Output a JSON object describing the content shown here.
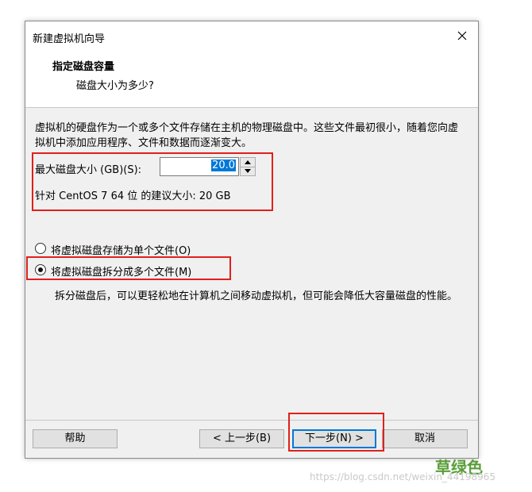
{
  "window": {
    "title": "新建虚拟机向导"
  },
  "header": {
    "title": "指定磁盘容量",
    "subtitle": "磁盘大小为多少?"
  },
  "content": {
    "description": "虚拟机的硬盘作为一个或多个文件存储在主机的物理磁盘中。这些文件最初很小，随着您向虚拟机中添加应用程序、文件和数据而逐渐变大。",
    "max_disk_size_label": "最大磁盘大小 (GB)(S):",
    "max_disk_size_value": "20.0",
    "recommended_size": "针对 CentOS 7 64 位 的建议大小: 20 GB",
    "options": [
      {
        "label": "将虚拟磁盘存储为单个文件(O)",
        "selected": false
      },
      {
        "label": "将虚拟磁盘拆分成多个文件(M)",
        "selected": true
      }
    ],
    "split_description": "拆分磁盘后，可以更轻松地在计算机之间移动虚拟机，但可能会降低大容量磁盘的性能。"
  },
  "buttons": {
    "help": "帮助",
    "back": "< 上一步(B)",
    "next": "下一步(N) >",
    "cancel": "取消"
  },
  "overlay": {
    "brand": "草绿色",
    "watermark": "https://blog.csdn.net/weixin_44198965"
  },
  "colors": {
    "annotation_red": "#e0201b",
    "selection_blue": "#0078d7",
    "brand_green": "#5a9e3a"
  }
}
